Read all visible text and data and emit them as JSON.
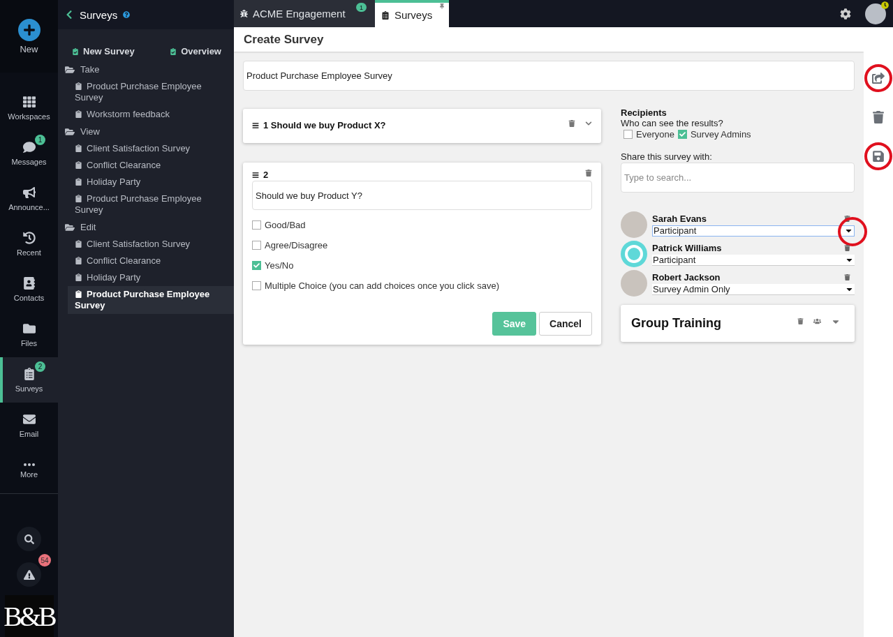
{
  "rail": {
    "new_label": "New",
    "items": [
      {
        "label": "Workspaces",
        "selected": false
      },
      {
        "label": "Messages",
        "badge": "1",
        "selected": false
      },
      {
        "label": "Announce...",
        "selected": false
      },
      {
        "label": "Recent",
        "selected": false
      },
      {
        "label": "Contacts",
        "selected": false
      },
      {
        "label": "Files",
        "selected": false
      },
      {
        "label": "Surveys",
        "badge": "2",
        "selected": true
      },
      {
        "label": "Email",
        "selected": false
      },
      {
        "label": "More",
        "selected": false
      }
    ],
    "alert_badge": "54",
    "logo": "B&B"
  },
  "sidebar": {
    "title": "Surveys",
    "actions": [
      "New Survey",
      "Overview"
    ],
    "sections": [
      {
        "label": "Take",
        "children": [
          {
            "label": "Product Purchase Employee Survey",
            "selected": false
          },
          {
            "label": "Workstorm feedback",
            "selected": false
          }
        ]
      },
      {
        "label": "View",
        "children": [
          {
            "label": "Client Satisfaction Survey",
            "selected": false
          },
          {
            "label": "Conflict Clearance",
            "selected": false
          },
          {
            "label": "Holiday Party",
            "selected": false
          },
          {
            "label": "Product Purchase Employee Survey",
            "selected": false
          }
        ]
      },
      {
        "label": "Edit",
        "children": [
          {
            "label": "Client Satisfaction Survey",
            "selected": false
          },
          {
            "label": "Conflict Clearance",
            "selected": false
          },
          {
            "label": "Holiday Party",
            "selected": false
          },
          {
            "label": "Product Purchase Employee Survey",
            "selected": true
          }
        ]
      }
    ]
  },
  "tabs": [
    {
      "label": "ACME Engagement",
      "badge": "1",
      "selected": false
    },
    {
      "label": "Surveys",
      "selected": true
    }
  ],
  "page_title": "Create Survey",
  "survey_title": "Product Purchase Employee Survey",
  "questions": [
    {
      "number": "1",
      "text": "Should we buy Product X?",
      "expanded": false
    },
    {
      "number": "2",
      "text": "Should we buy Product Y?",
      "expanded": true,
      "options": [
        {
          "label": "Good/Bad",
          "checked": false
        },
        {
          "label": "Agree/Disagree",
          "checked": false
        },
        {
          "label": "Yes/No",
          "checked": true
        },
        {
          "label": "Multiple Choice (you can add choices once you click save)",
          "checked": false
        }
      ],
      "buttons": [
        "Save",
        "Cancel"
      ]
    }
  ],
  "recipients": {
    "title": "Recipients",
    "question": "Who can see the results?",
    "visibility": [
      {
        "label": "Everyone",
        "checked": false
      },
      {
        "label": "Survey Admins",
        "checked": true
      }
    ],
    "share_label": "Share this survey with:",
    "search_placeholder": "Type to search...",
    "people": [
      {
        "name": "Sarah Evans",
        "role": "Participant",
        "kind": "photo",
        "focused": true,
        "highlighted": true
      },
      {
        "name": "Patrick Williams",
        "role": "Participant",
        "kind": "ring",
        "focused": false,
        "highlighted": false
      },
      {
        "name": "Robert Jackson",
        "role": "Survey Admin Only",
        "kind": "photo",
        "focused": false,
        "highlighted": false
      }
    ],
    "group": {
      "name": "Group Training"
    }
  },
  "actions": [
    {
      "kind": "share",
      "highlighted": true
    },
    {
      "kind": "delete",
      "highlighted": false
    },
    {
      "kind": "save",
      "highlighted": true
    }
  ]
}
